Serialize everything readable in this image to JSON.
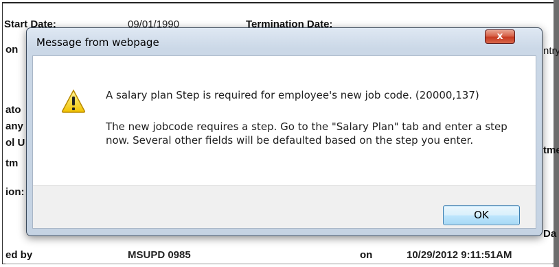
{
  "background": {
    "labels": {
      "start_date": "Start Date:",
      "termination_date": "Termination Date:",
      "on": "on",
      "entry": "ntry",
      "ato": "ato",
      "any": "any",
      "ol_u": "ol U",
      "tm": "tm",
      "ion": "ion:",
      "tm_right": "tme",
      "da": "Da",
      "ed_by": "ed by",
      "on_bottom": "on"
    },
    "values": {
      "start_date_value": "09/01/1990",
      "updated_by_value": "MSUPD 0985",
      "updated_on_value": "10/29/2012  9:11:51AM"
    }
  },
  "dialog": {
    "title": "Message from webpage",
    "close_label": "x",
    "message_primary": "A salary plan Step is required for employee's new job code. (20000,137)",
    "message_secondary": "The new jobcode requires a step.  Go to the \"Salary Plan\" tab and enter a step now.  Several other fields will be defaulted based on the step you enter.",
    "ok_label": "OK",
    "icon": "warning-icon"
  },
  "colors": {
    "dialog_frame": "#c5d3e3",
    "close_button": "#c73b22",
    "ok_button": "#bee6fd"
  }
}
